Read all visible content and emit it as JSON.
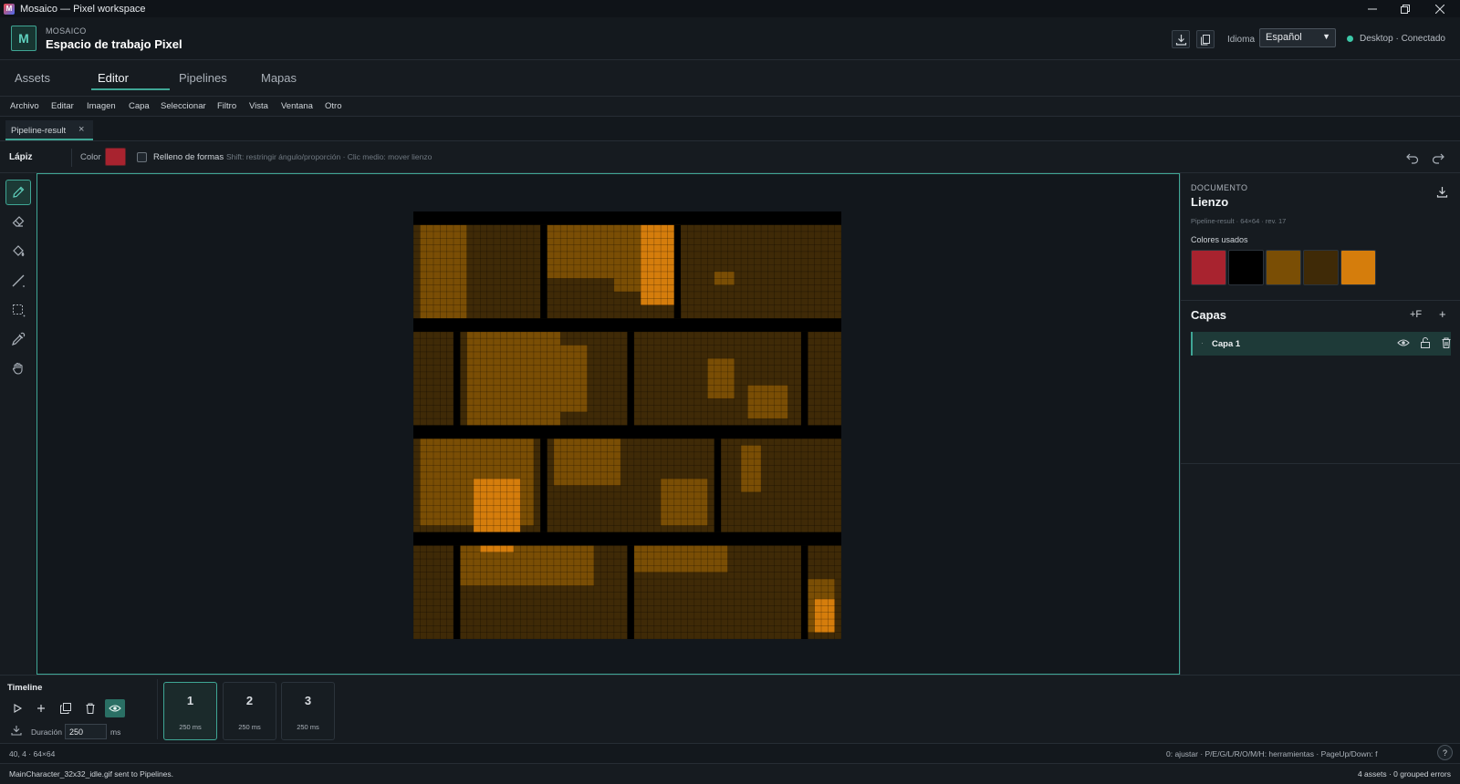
{
  "window": {
    "title": "Mosaico — Pixel workspace",
    "app_icon_letter": "M"
  },
  "header": {
    "logo_letter": "M",
    "brand_small": "MOSAICO",
    "brand_title": "Espacio de trabajo Pixel",
    "language_label": "Idioma",
    "language_value": "Español",
    "status_text": "Desktop · Conectado",
    "status_color": "#3cc8a8"
  },
  "main_tabs": [
    "Assets",
    "Editor",
    "Pipelines",
    "Mapas"
  ],
  "main_tab_active": "Editor",
  "menu": [
    "Archivo",
    "Editar",
    "Imagen",
    "Capa",
    "Seleccionar",
    "Filtro",
    "Vista",
    "Ventana",
    "Otro"
  ],
  "doc_tab": {
    "label": "Pipeline-result",
    "close": "×"
  },
  "tool_options": {
    "tool_name": "Lápiz",
    "color_label": "Color",
    "current_color": "#a8232f",
    "fill_label": "Relleno de formas",
    "fill_checked": false,
    "hint": "Shift: restringir ángulo/proporción · Clic medio: mover lienzo"
  },
  "tools": [
    "pencil-icon",
    "eraser-icon",
    "fill-bucket-icon",
    "line-icon",
    "marquee-select-icon",
    "eyedropper-icon",
    "hand-icon"
  ],
  "active_tool": "pencil-icon",
  "canvas_grid": {
    "columns": 64,
    "rows": 64
  },
  "document": {
    "caption": "DOCUMENTO",
    "title": "Lienzo",
    "meta": "Pipeline-result · 64×64 · rev. 17",
    "used_colors_label": "Colores usados",
    "used_colors": [
      "#a8232f",
      "#000000",
      "#7a4e05",
      "#3f2a07",
      "#d57d0c"
    ]
  },
  "layers": {
    "title": "Capas",
    "add_folder": "+F",
    "add": "+",
    "items": [
      {
        "name": "Capa 1",
        "visible": true,
        "locked": false
      }
    ]
  },
  "timeline": {
    "title": "Timeline",
    "duration_label": "Duración",
    "duration_value": "250",
    "duration_unit": "ms",
    "frames": [
      {
        "number": "1",
        "ms": "250 ms"
      },
      {
        "number": "2",
        "ms": "250 ms"
      },
      {
        "number": "3",
        "ms": "250 ms"
      }
    ],
    "active_frame": "1"
  },
  "status": {
    "coords": "40, 4 · 64×64",
    "shortcuts": "0: ajustar · P/E/G/L/R/O/M/H: herramientas · PageUp/Down: f",
    "log": "MainCharacter_32x32_idle.gif sent to Pipelines.",
    "assets": "4 assets · 0 grouped errors",
    "help": "?"
  },
  "accent_color": "#3fa695"
}
